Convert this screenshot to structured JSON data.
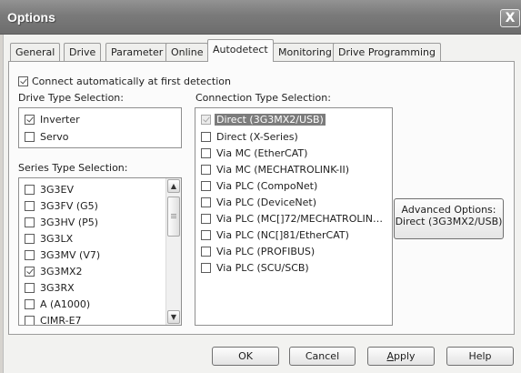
{
  "window": {
    "title": "Options",
    "close_glyph": "X"
  },
  "tabs": [
    {
      "label": "General",
      "active": false
    },
    {
      "label": "Drive",
      "active": false
    },
    {
      "label": "Parameter",
      "active": false
    },
    {
      "label": "Online",
      "active": false
    },
    {
      "label": "Autodetect",
      "active": true
    },
    {
      "label": "Monitoring",
      "active": false
    },
    {
      "label": "Drive Programming",
      "active": false
    }
  ],
  "connect_auto": {
    "label": "Connect automatically at first detection",
    "checked": true
  },
  "drive_type": {
    "heading": "Drive Type Selection:",
    "items": [
      {
        "label": "Inverter",
        "checked": true
      },
      {
        "label": "Servo",
        "checked": false
      }
    ]
  },
  "series_type": {
    "heading": "Series Type Selection:",
    "items": [
      {
        "label": "3G3EV",
        "checked": false
      },
      {
        "label": "3G3FV (G5)",
        "checked": false
      },
      {
        "label": "3G3HV (P5)",
        "checked": false
      },
      {
        "label": "3G3LX",
        "checked": false
      },
      {
        "label": "3G3MV (V7)",
        "checked": false
      },
      {
        "label": "3G3MX2",
        "checked": true
      },
      {
        "label": "3G3RX",
        "checked": false
      },
      {
        "label": "A (A1000)",
        "checked": false
      },
      {
        "label": "CIMR-E7",
        "checked": false
      }
    ]
  },
  "connection_type": {
    "heading": "Connection Type Selection:",
    "items": [
      {
        "label": "Direct (3G3MX2/USB)",
        "checked": true,
        "selected": true,
        "disabled": true
      },
      {
        "label": "Direct (X-Series)",
        "checked": false
      },
      {
        "label": "Via MC (EtherCAT)",
        "checked": false
      },
      {
        "label": "Via MC (MECHATROLINK-II)",
        "checked": false
      },
      {
        "label": "Via PLC (CompoNet)",
        "checked": false
      },
      {
        "label": "Via PLC (DeviceNet)",
        "checked": false
      },
      {
        "label": "Via PLC (MC[]72/MECHATROLIN…",
        "checked": false
      },
      {
        "label": "Via PLC (NC[]81/EtherCAT)",
        "checked": false
      },
      {
        "label": "Via PLC (PROFIBUS)",
        "checked": false
      },
      {
        "label": "Via PLC (SCU/SCB)",
        "checked": false
      }
    ]
  },
  "advanced_button": {
    "line1": "Advanced Options:",
    "line2": "Direct (3G3MX2/USB)"
  },
  "buttons": {
    "ok": "OK",
    "cancel": "Cancel",
    "apply_mnemonic": "A",
    "apply_rest": "pply",
    "help": "Help"
  },
  "colors": {
    "selection": "#7c7c7c",
    "titlebar": "#7a7a7a",
    "panel": "#fbfbfb"
  }
}
